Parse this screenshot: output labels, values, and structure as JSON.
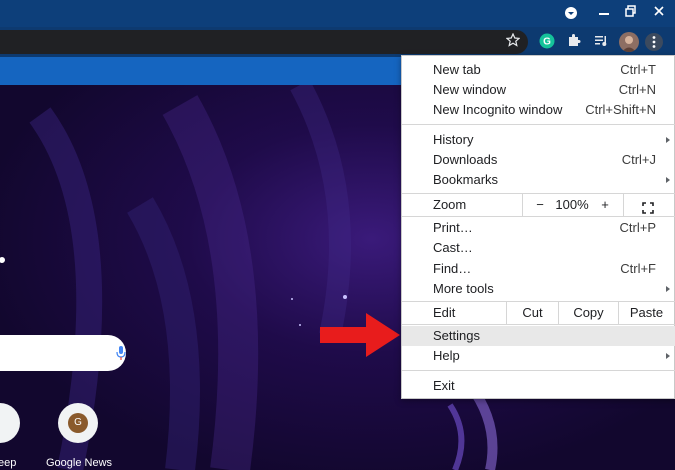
{
  "titlebar": {
    "icons": [
      "dropdown-icon",
      "minimize-icon",
      "restore-icon",
      "close-icon"
    ]
  },
  "toolbar": {
    "icons": [
      "star-icon",
      "grammarly-icon",
      "extensions-icon",
      "media-icon",
      "profile-avatar",
      "more-menu-icon"
    ]
  },
  "ntp": {
    "shortcuts": [
      {
        "label": "eep"
      },
      {
        "label": "Google News",
        "badge": "G"
      }
    ]
  },
  "menu": {
    "new_tab": {
      "label": "New tab",
      "shortcut": "Ctrl+T"
    },
    "new_window": {
      "label": "New window",
      "shortcut": "Ctrl+N"
    },
    "new_incognito": {
      "label": "New Incognito window",
      "shortcut": "Ctrl+Shift+N"
    },
    "history": {
      "label": "History"
    },
    "downloads": {
      "label": "Downloads",
      "shortcut": "Ctrl+J"
    },
    "bookmarks": {
      "label": "Bookmarks"
    },
    "zoom": {
      "label": "Zoom",
      "minus": "−",
      "value": "100%",
      "plus": "+"
    },
    "print": {
      "label": "Print…",
      "shortcut": "Ctrl+P"
    },
    "cast": {
      "label": "Cast…"
    },
    "find": {
      "label": "Find…",
      "shortcut": "Ctrl+F"
    },
    "more_tools": {
      "label": "More tools"
    },
    "edit": {
      "label": "Edit",
      "cut": "Cut",
      "copy": "Copy",
      "paste": "Paste"
    },
    "settings": {
      "label": "Settings"
    },
    "help": {
      "label": "Help"
    },
    "exit": {
      "label": "Exit"
    }
  },
  "colors": {
    "accent_arrow": "#e81c1c",
    "titlebar": "#0d3f7a",
    "bookmark_bar": "#1565c0"
  }
}
